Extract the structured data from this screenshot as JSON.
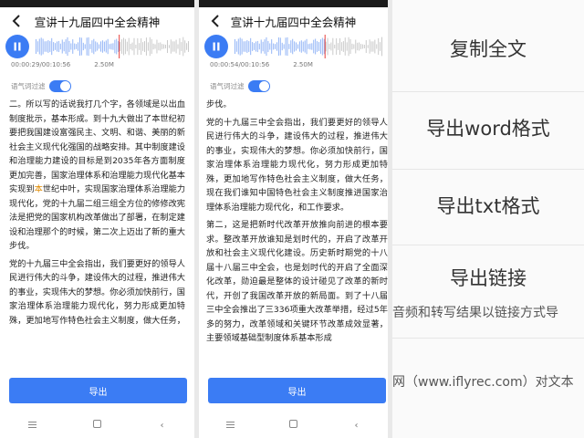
{
  "screen1": {
    "title": "宣讲十九届四中全会精神",
    "time": "00:00:29/00:10:56",
    "size": "2.50M",
    "filter_label": "语气词过滤",
    "paragraphs": [
      [
        "二。所以写的话说我打几个字，各领域是以出血制度批示，基本形成。到十九大做出了本世纪初要把我国建设富强民主、文明、和谐、美丽的新社会主义现代化强国的战略安排。其中制度建设和治理能力建设的目标是到2035年各方面制度更加完善，国家治理体系和治理能力现代化基本实现到",
        "本",
        "世纪中叶，实现国家治理体系治理能力现代化，党的十九届二组三组全方位的修修改宪法是把党的国家机构改革做出了部署，在制定建设和治理那个的时候，第二次上迈出了新的重大步伐。"
      ],
      [
        "党的十九届三中全会指出，我们要更好的领导人民进行伟大的斗争，建设伟大的过程，推进伟大的事业，实现伟大的梦想。你必须加快前行，国家治理体系治理能力现代化，努力形成更加特殊，更加地写作特色社会主义制度，做大任务，"
      ]
    ],
    "export_label": "导出"
  },
  "screen2": {
    "title": "宣讲十九届四中全会精神",
    "time": "00:00:54/00:10:56",
    "size": "2.50M",
    "filter_label": "语气词过滤",
    "paragraphs": [
      "步伐。",
      "党的十九届三中全会指出，我们要更好的领导人民进行伟大的斗争，建设伟大的过程，推进伟大的事业，实现伟大的梦想。你必须加快前行，国家治理体系治理能力现代化，努力形成更加特殊，更加地写作特色社会主义制度，做大任务，现在我们谁知中国特色社会主义制度推进国家治理体系治理能力现代化，和工作要求。",
      "第二，这是把新时代改革开放推向前进的根本要求。整改革开放谁知是划时代的，开启了改革开放和社会主义现代化建设。历史新时期党的十八届十八届三中全会，也是划时代的开启了全面深化改革，勋迫最是整体的设计碰见了改革的新时代，开创了我国改革开放的新局面。到了十八届三中全会推出了三336项重大改革举措，经过5年多的努力，改革领域和关键环节改革成效显著，主要领域基础型制度体系基本形成"
    ],
    "export_label": "导出"
  },
  "screen3": {
    "menu": [
      "复制全文",
      "导出word格式",
      "导出txt格式",
      "导出链接"
    ],
    "overflow_line1": "音频和转写结果以链接方式导",
    "overflow_line2": "网（www.iflyrec.com）对文本"
  },
  "colors": {
    "accent": "#3b7cf4",
    "highlight": "#e08a00"
  },
  "icons": [
    "back-arrow-icon",
    "pause-icon",
    "menu-icon",
    "home-icon",
    "back-nav-icon"
  ]
}
